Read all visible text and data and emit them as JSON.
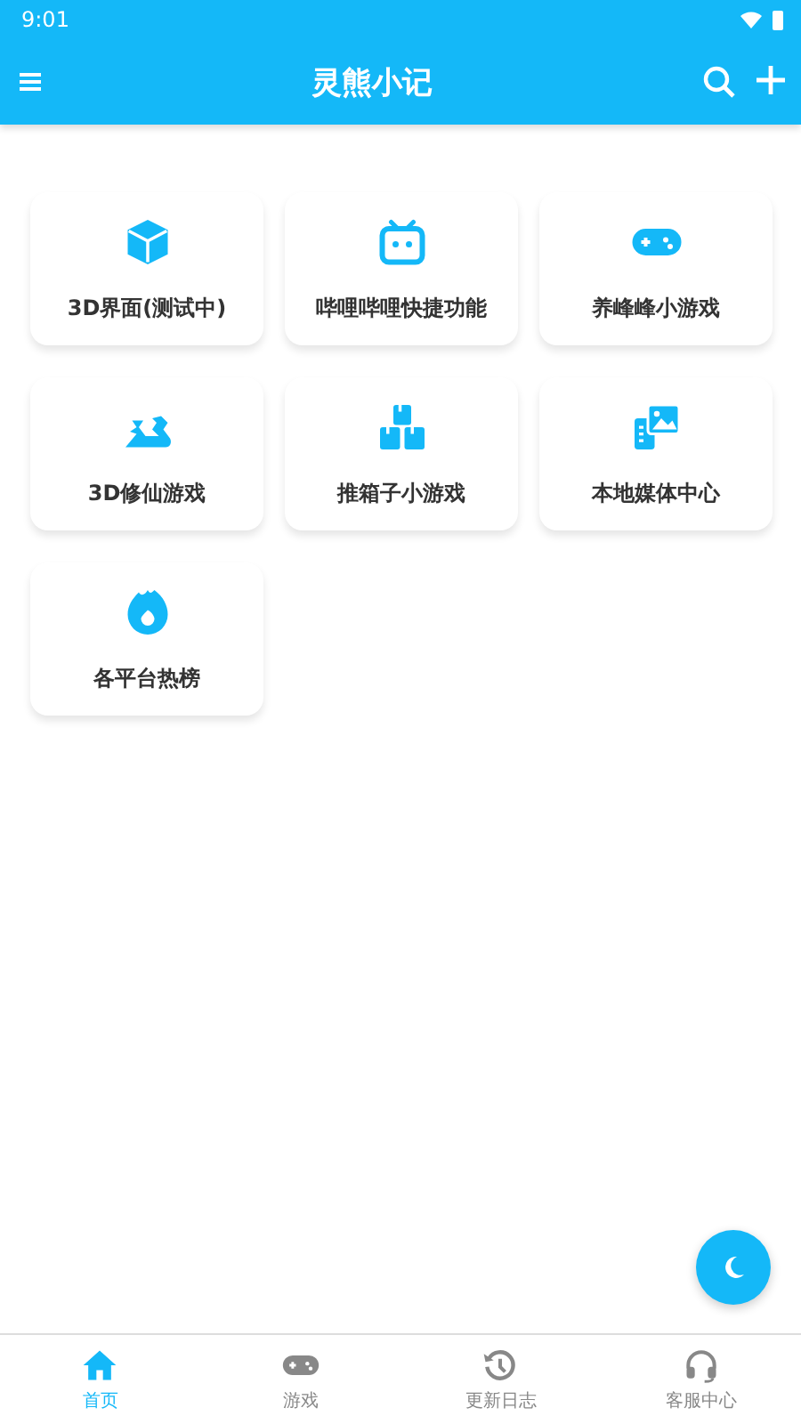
{
  "status_bar": {
    "time": "9:01"
  },
  "app_bar": {
    "title": "灵熊小记"
  },
  "cards": [
    {
      "label": "3D界面(测试中)"
    },
    {
      "label": "哔哩哔哩快捷功能"
    },
    {
      "label": "养峰峰小游戏"
    },
    {
      "label": "3D修仙游戏"
    },
    {
      "label": "推箱子小游戏"
    },
    {
      "label": "本地媒体中心"
    },
    {
      "label": "各平台热榜"
    }
  ],
  "bottom_nav": [
    {
      "label": "首页",
      "selected": true
    },
    {
      "label": "游戏",
      "selected": false
    },
    {
      "label": "更新日志",
      "selected": false
    },
    {
      "label": "客服中心",
      "selected": false
    }
  ]
}
